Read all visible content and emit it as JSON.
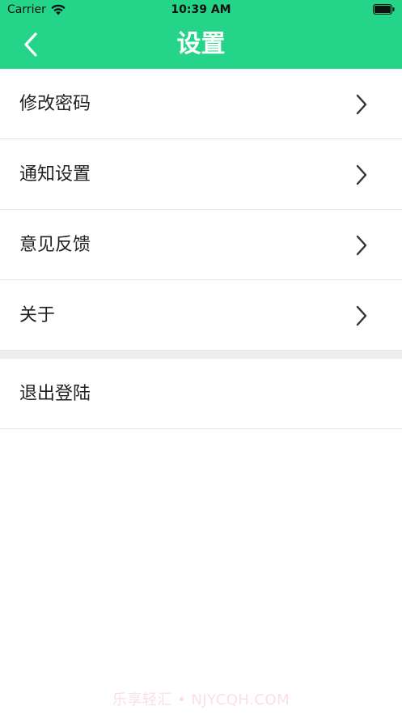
{
  "status_bar": {
    "carrier": "Carrier",
    "time": "10:39 AM",
    "wifi_icon": "wifi-icon",
    "battery_icon": "battery-icon"
  },
  "header": {
    "title": "设置",
    "back_icon": "chevron-left-icon",
    "color": "#24d488"
  },
  "settings": {
    "items": [
      {
        "label": "修改密码",
        "icon": "chevron-right-icon"
      },
      {
        "label": "通知设置",
        "icon": "chevron-right-icon"
      },
      {
        "label": "意见反馈",
        "icon": "chevron-right-icon"
      },
      {
        "label": "关于",
        "icon": "chevron-right-icon"
      }
    ],
    "logout_label": "退出登陆"
  },
  "watermark": {
    "text": "乐享轻汇 • NJYCQH.COM"
  }
}
